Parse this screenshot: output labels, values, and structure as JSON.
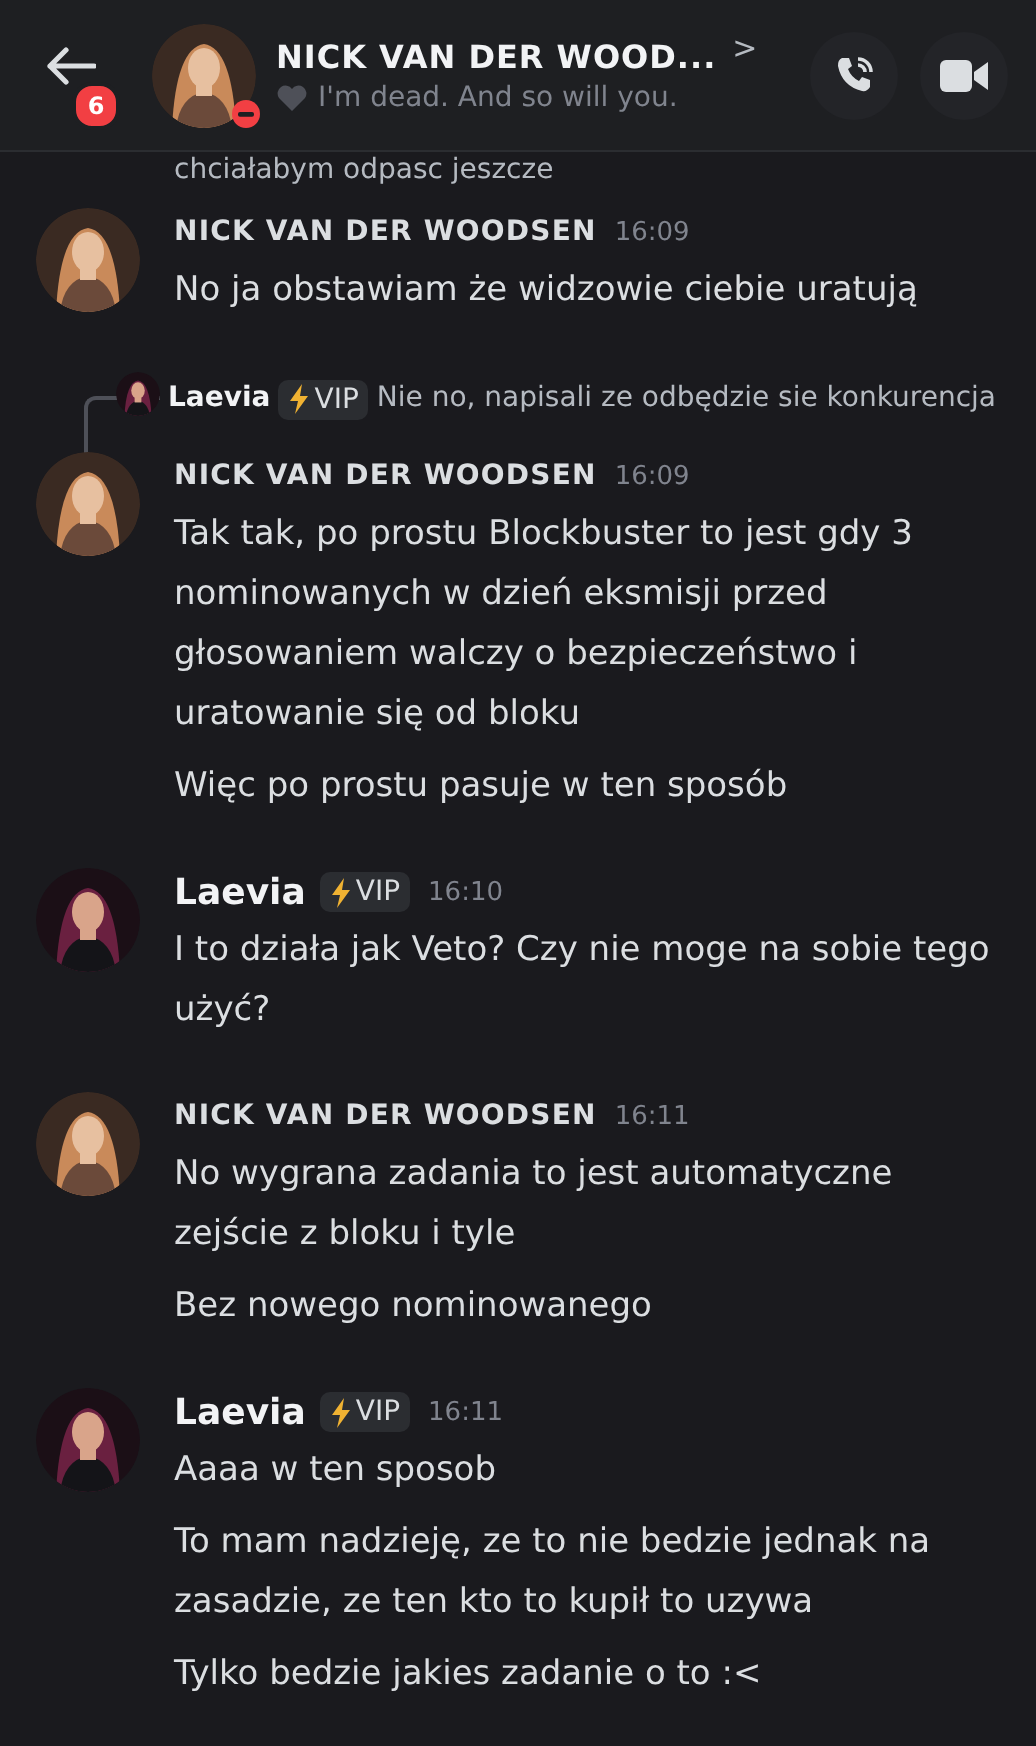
{
  "header": {
    "unread_count": "6",
    "title": "NICK VAN DER WOOD...",
    "chevron": ">",
    "status_text": "I'm dead. And so will you."
  },
  "top_fragment": "chciałabym odpasc jeszcze",
  "messages": [
    {
      "author": "NICK VAN DER WOODSEN",
      "kind": "nick",
      "time": "16:09",
      "lines": [
        "No ja obstawiam że widzowie ciebie uratują"
      ]
    },
    {
      "author": "NICK VAN DER WOODSEN",
      "kind": "nick",
      "time": "16:09",
      "reply": {
        "author": "Laevia",
        "kind": "laevia",
        "badge": "VIP",
        "text": "Nie no, napisali ze odbędzie sie konkurencja"
      },
      "lines": [
        "Tak tak, po prostu Blockbuster to jest gdy 3 nominowanych w dzień eksmisji przed głosowaniem walczy o bezpieczeństwo i uratowanie się od bloku",
        "Więc po prostu pasuje w ten sposób"
      ]
    },
    {
      "author": "Laevia",
      "kind": "laevia",
      "badge": "VIP",
      "time": "16:10",
      "lines": [
        "I to działa jak Veto? Czy nie moge na sobie tego użyć?"
      ]
    },
    {
      "author": "NICK VAN DER WOODSEN",
      "kind": "nick",
      "time": "16:11",
      "lines": [
        "No wygrana zadania to jest automatyczne zejście z bloku i tyle",
        "Bez nowego nominowanego"
      ]
    },
    {
      "author": "Laevia",
      "kind": "laevia",
      "badge": "VIP",
      "time": "16:11",
      "lines": [
        "Aaaa w ten sposob",
        "To mam nadzieję, ze to nie bedzie jednak na zasadzie, ze ten kto to kupił to uzywa",
        "Tylko bedzie jakies zadanie o to :<"
      ]
    }
  ]
}
